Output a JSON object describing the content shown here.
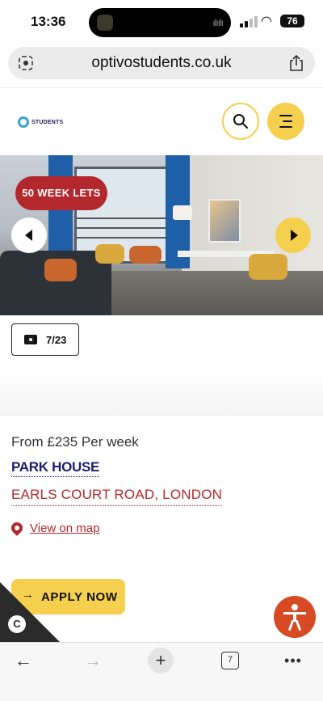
{
  "status_bar": {
    "time": "13:36",
    "battery": "76",
    "icons": [
      "signal-icon",
      "wifi-icon",
      "battery-icon"
    ]
  },
  "browser": {
    "url": "optivostudents.co.uk",
    "tab_count": "7"
  },
  "header": {
    "logo_text": "STUDENTS",
    "icons": [
      "search-icon",
      "menu-icon"
    ]
  },
  "gallery": {
    "badge": "50 WEEK LETS",
    "photo_counter": "7/23"
  },
  "property": {
    "price": "From £235 Per week",
    "name": "PARK HOUSE",
    "address": "EARLS COURT ROAD, LONDON",
    "map_link": "View on map"
  },
  "actions": {
    "apply_label": "APPLY NOW",
    "apply_arrow": "→"
  },
  "colors": {
    "accent_yellow": "#f5cf4e",
    "brand_red": "#b3282d",
    "navy": "#1d1d6b",
    "a11y_orange": "#d64a24"
  }
}
